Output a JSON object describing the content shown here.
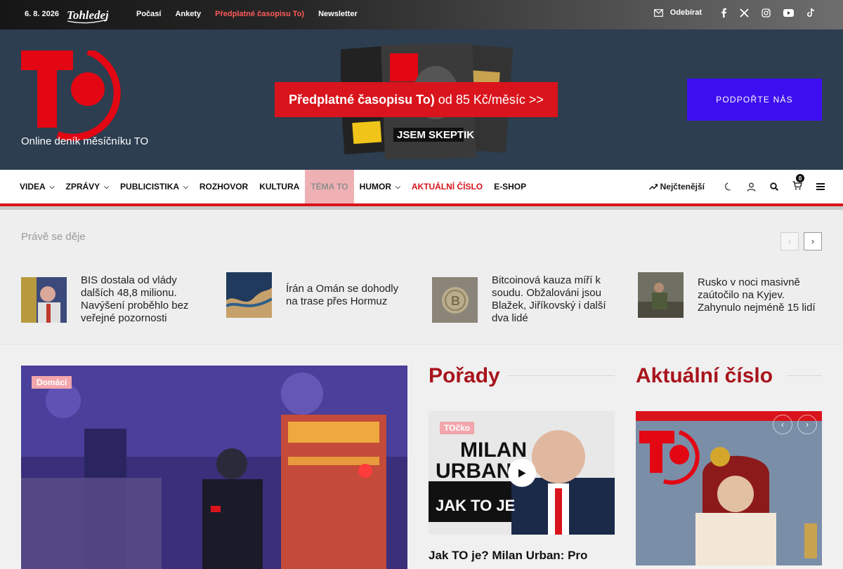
{
  "topbar": {
    "date": "6. 8. 2026",
    "nav": [
      "Počasí",
      "Ankety",
      "Předplatné časopisu To)",
      "Newsletter"
    ],
    "subscribe": "Odebírat"
  },
  "header": {
    "tagline": "Online deník měsíčníku TO",
    "promo_bold": "Předplatné časopisu To)",
    "promo_rest": "od 85 Kč/měsíc >>",
    "support": "PODPOŘTE NÁS"
  },
  "mainnav": {
    "items": [
      "VIDEA",
      "ZPRÁVY",
      "PUBLICISTIKA",
      "ROZHOVOR",
      "KULTURA",
      "TÉMA TO",
      "HUMOR",
      "AKTUÁLNÍ ČÍSLO",
      "E-SHOP"
    ],
    "trending": "Nejčtenější",
    "cart_count": "0"
  },
  "breaking": {
    "label": "Právě se děje",
    "items": [
      "BIS dostala od vlády dalších 48,8 milionu. Navýšení proběhlo bez veřejné pozornosti",
      "Írán a Omán se dohodly na trase přes Hormuz",
      "Bitcoinová kauza míří k soudu. Obžalováni jsou Blažek, Jiříkovský i další dva lidé",
      "Rusko v noci masivně zaútočilo na Kyjev. Zahynulo nejméně 15 lidí"
    ]
  },
  "content": {
    "hero_category": "Domácí",
    "shows_title": "Pořady",
    "show_category": "TOčko",
    "show_headline": "Jak TO je? Milan Urban: Pro",
    "issue_title": "Aktuální číslo"
  },
  "colors": {
    "brand_red": "#d9141c",
    "support_blue": "#3d0ff0",
    "header_bg": "#2c3e50"
  }
}
